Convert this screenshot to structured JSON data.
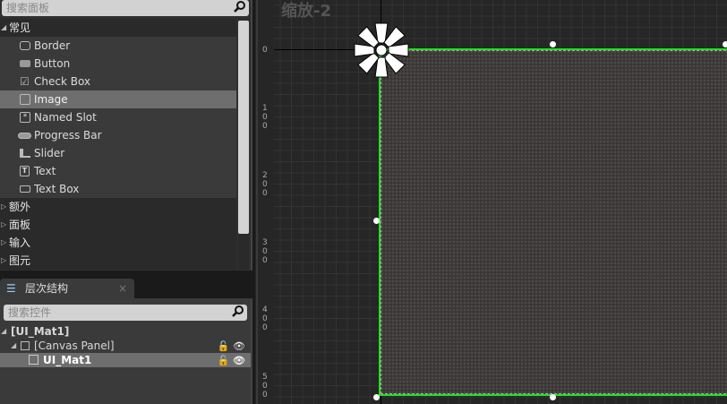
{
  "palette": {
    "search_placeholder": "搜索面板",
    "categories": [
      {
        "label": "常见",
        "expanded": true
      },
      {
        "label": "额外"
      },
      {
        "label": "面板"
      },
      {
        "label": "输入"
      },
      {
        "label": "图元"
      }
    ],
    "items": [
      {
        "label": "Border",
        "icon": "border-icon"
      },
      {
        "label": "Button",
        "icon": "button-icon"
      },
      {
        "label": "Check Box",
        "icon": "checkbox-icon"
      },
      {
        "label": "Image",
        "icon": "image-icon",
        "selected": true
      },
      {
        "label": "Named Slot",
        "icon": "named-slot-icon"
      },
      {
        "label": "Progress Bar",
        "icon": "progress-bar-icon"
      },
      {
        "label": "Slider",
        "icon": "slider-icon"
      },
      {
        "label": "Text",
        "icon": "text-icon"
      },
      {
        "label": "Text Box",
        "icon": "text-box-icon"
      }
    ]
  },
  "hierarchy": {
    "tab_label": "层次结构",
    "close": "×",
    "search_placeholder": "搜索控件",
    "tree": [
      {
        "label": "[UI_Mat1]"
      },
      {
        "label": "[Canvas Panel]"
      },
      {
        "label": "UI_Mat1",
        "selected": true
      }
    ]
  },
  "canvas": {
    "zoom_label": "缩放-2",
    "ruler": [
      "0",
      "100",
      "200",
      "300",
      "400",
      "500"
    ],
    "selection_color": "#22e01e"
  }
}
